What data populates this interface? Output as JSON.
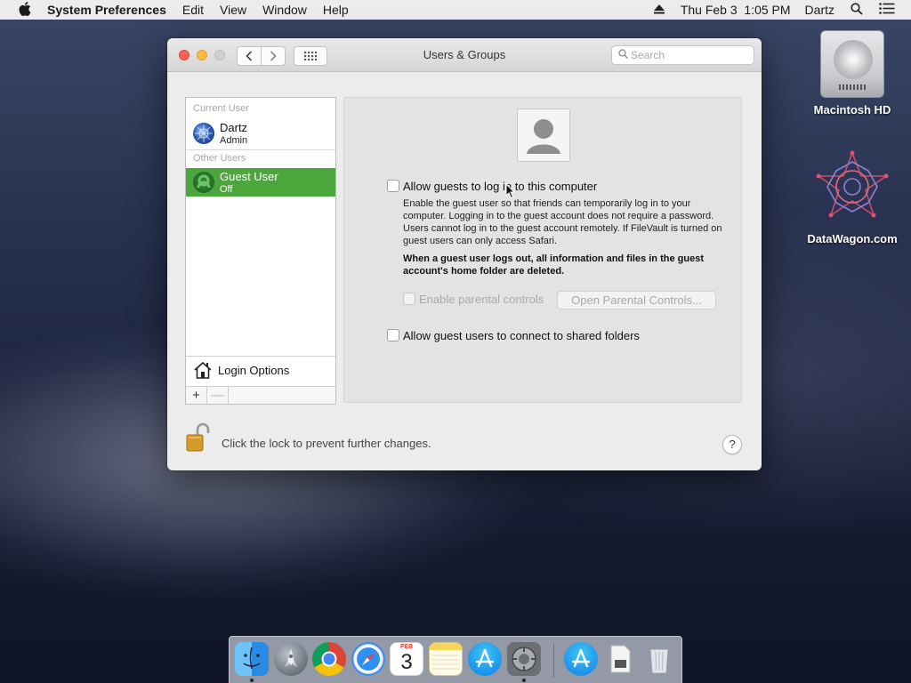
{
  "menubar": {
    "apple_icon": "apple-icon",
    "app_name": "System Preferences",
    "menus": [
      "Edit",
      "View",
      "Window",
      "Help"
    ],
    "clock": "Thu Feb 3  1:05 PM",
    "user": "Dartz"
  },
  "desktop": {
    "icons": [
      {
        "label": "Macintosh HD",
        "icon": "hard-drive-icon"
      },
      {
        "label": "DataWagon.com",
        "icon": "datawagon-logo-icon"
      }
    ]
  },
  "window": {
    "title": "Users & Groups",
    "search_placeholder": "Search"
  },
  "user_list": {
    "current_user_header": "Current User",
    "other_users_header": "Other Users",
    "current_user": {
      "name": "Dartz",
      "role": "Admin"
    },
    "other_users": [
      {
        "name": "Guest User",
        "status": "Off",
        "selected": true
      }
    ],
    "login_options": "Login Options",
    "add_label": "+",
    "remove_label": "—"
  },
  "guest_pane": {
    "allow_login_label": "Allow guests to log in to this computer",
    "allow_login_checked": false,
    "description": "Enable the guest user so that friends can temporarily log in to your computer. Logging in to the guest account does not require a password. Users cannot log in to the guest account remotely. If FileVault is turned on guest users can only access Safari.",
    "warning": "When a guest user logs out, all information and files in the guest account's home folder are deleted.",
    "parental_controls_label": "Enable parental controls",
    "open_parental_controls_button": "Open Parental Controls...",
    "shared_folders_label": "Allow guest users to connect to shared folders",
    "shared_folders_checked": false
  },
  "footer": {
    "lock_text": "Click the lock to prevent further changes.",
    "help_label": "?"
  },
  "dock": {
    "items": [
      "finder-icon",
      "launchpad-icon",
      "chrome-icon",
      "safari-icon",
      "calendar-icon",
      "notes-icon",
      "app-store-icon",
      "system-preferences-icon",
      "app-store-icon",
      "file-icon",
      "trash-icon"
    ],
    "calendar_month": "FEB",
    "calendar_day": "3"
  },
  "colors": {
    "selection": "#4ba63c",
    "close": "#fc605b",
    "minimize": "#fdbc40"
  }
}
